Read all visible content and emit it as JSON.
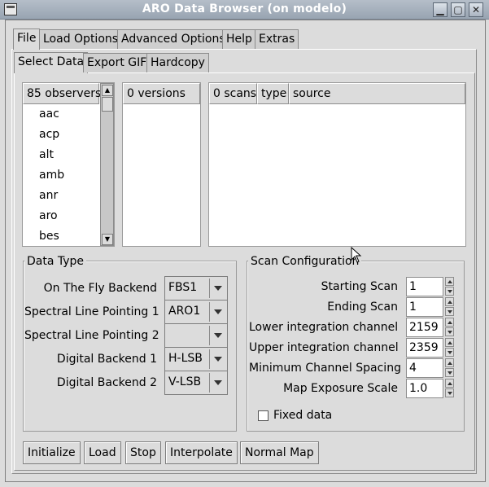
{
  "window": {
    "title": "ARO Data Browser (on modelo)",
    "controls": {
      "minimize": "▁",
      "maximize": "▢",
      "close": "✕"
    }
  },
  "tabs": [
    "File",
    "Load Options",
    "Advanced Options",
    "Help",
    "Extras"
  ],
  "subtabs": [
    "Select Data",
    "Export GIF",
    "Hardcopy"
  ],
  "lists": {
    "observers_header": "85 observers",
    "observers": [
      "aac",
      "acp",
      "alt",
      "amb",
      "anr",
      "aro",
      "bes"
    ],
    "versions_header": "0 versions",
    "scans_header": "0 scans",
    "type_header": "type",
    "source_header": "source"
  },
  "data_type": {
    "title": "Data Type",
    "rows": [
      {
        "label": "On The Fly Backend",
        "value": "FBS1"
      },
      {
        "label": "Spectral Line Pointing 1",
        "value": "ARO1"
      },
      {
        "label": "Spectral Line Pointing 2",
        "value": ""
      },
      {
        "label": "Digital Backend 1",
        "value": "H-LSB"
      },
      {
        "label": "Digital Backend 2",
        "value": "V-LSB"
      }
    ]
  },
  "scan_config": {
    "title": "Scan Configuration",
    "rows": [
      {
        "label": "Starting Scan",
        "value": "1"
      },
      {
        "label": "Ending Scan",
        "value": "1"
      },
      {
        "label": "Lower integration channel",
        "value": "2159"
      },
      {
        "label": "Upper integration channel",
        "value": "2359"
      },
      {
        "label": "Minimum Channel Spacing",
        "value": "4"
      },
      {
        "label": "Map Exposure Scale",
        "value": "1.0"
      }
    ],
    "fixed_data_label": "Fixed data",
    "fixed_data_checked": false
  },
  "buttons": [
    "Initialize",
    "Load",
    "Stop",
    "Interpolate",
    "Normal Map"
  ]
}
